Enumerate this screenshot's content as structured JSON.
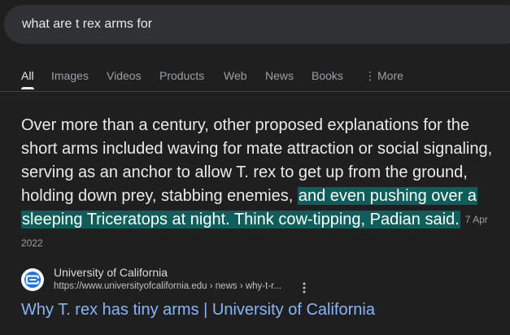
{
  "search": {
    "query": "what are t rex arms for"
  },
  "tabs": [
    {
      "label": "All",
      "active": true
    },
    {
      "label": "Images"
    },
    {
      "label": "Videos"
    },
    {
      "label": "Products"
    },
    {
      "label": "Web"
    },
    {
      "label": "News"
    },
    {
      "label": "Books"
    },
    {
      "label": "More",
      "icon": "more-vert-icon"
    }
  ],
  "snippet": {
    "text_plain": "Over more than a century, other proposed explanations for the short arms included waving for mate attraction or social signaling, serving as an anchor to allow T. rex to get up from the ground, holding down prey, stabbing enemies, ",
    "text_highlight": "and even pushing over a sleeping Triceratops at night. Think cow-tipping, Padian said.",
    "date": "7 Apr 2022"
  },
  "result": {
    "site_name": "University of California",
    "url": "https://www.universityofcalifornia.edu › news › why-t-r...",
    "title": "Why T. rex has tiny arms | University of California",
    "favicon": "university-of-california-logo-icon",
    "menu_icon": "more-vert-icon"
  },
  "colors": {
    "background": "#1f1f1f",
    "search_box": "#303134",
    "highlight": "#0e5e5b",
    "link": "#8ab4f8",
    "muted": "#9aa0a6"
  }
}
